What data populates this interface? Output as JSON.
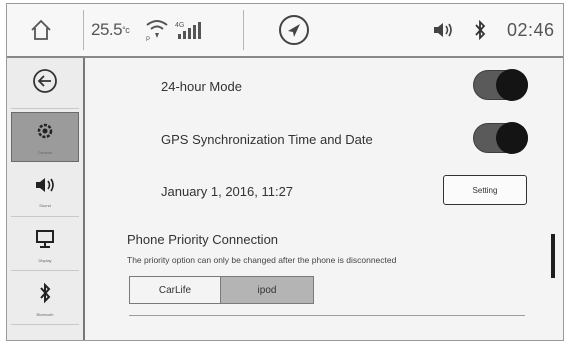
{
  "status_bar": {
    "temperature_value": "25.5",
    "temperature_unit": "°c",
    "time": "02:46",
    "icons": [
      "home-icon",
      "wifi-icon",
      "signal-icon",
      "navigation-icon",
      "volume-icon",
      "bluetooth-icon"
    ]
  },
  "sidebar": {
    "items": [
      {
        "name": "back",
        "label": "",
        "icon": "back-arrow-icon"
      },
      {
        "name": "general",
        "label": "General",
        "icon": "gear-icon",
        "active": true
      },
      {
        "name": "sound",
        "label": "Sound",
        "icon": "volume-icon"
      },
      {
        "name": "display",
        "label": "Display",
        "icon": "display-icon"
      },
      {
        "name": "bluetooth",
        "label": "Bluetooth",
        "icon": "bluetooth-icon"
      }
    ]
  },
  "settings": {
    "hour24": {
      "label": "24-hour Mode",
      "on": true
    },
    "gps_sync": {
      "label": "GPS Synchronization Time and Date",
      "on": true
    },
    "date_time": {
      "value": "January 1, 2016, 11:27",
      "button_label": "Setting"
    }
  },
  "phone_priority": {
    "title": "Phone Priority Connection",
    "note": "The priority option can only be changed after the phone is disconnected",
    "options": [
      "CarLife",
      "ipod"
    ],
    "selected_index": 1
  },
  "colors": {
    "toggle_on": "#141414",
    "active_side": "#9b9b9b"
  }
}
